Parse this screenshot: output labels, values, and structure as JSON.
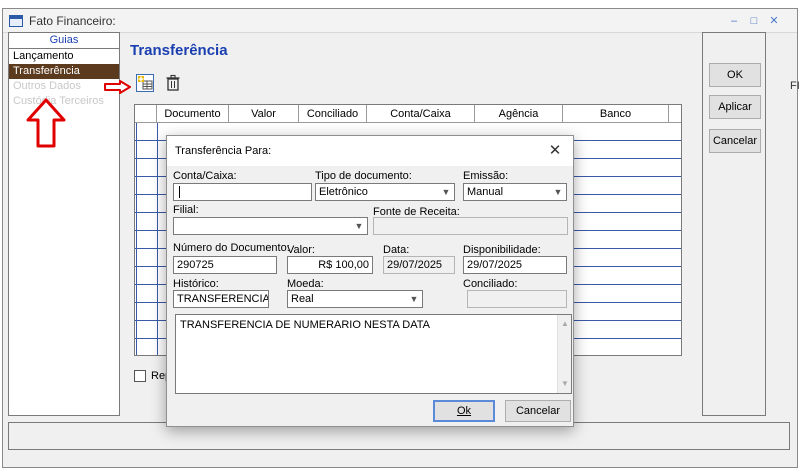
{
  "window": {
    "title": "Fato Financeiro:",
    "controls": {
      "minimize": "–",
      "maximize": "□",
      "close": "✕"
    }
  },
  "sidebar": {
    "header": "Guias",
    "items": [
      {
        "label": "Lançamento",
        "state": "normal"
      },
      {
        "label": "Transferência",
        "state": "active"
      },
      {
        "label": "Outros Dados",
        "state": "disabled"
      },
      {
        "label": "Custódia Terceiros",
        "state": "disabled"
      }
    ]
  },
  "main": {
    "title": "Transferência",
    "toolbar": {
      "add_icon": "add-row-icon",
      "delete_icon": "trash-icon"
    },
    "grid": {
      "columns": [
        "Documento",
        "Valor",
        "Conciliado",
        "Conta/Caixa",
        "Agência",
        "Banco"
      ]
    },
    "repeat_label": "Rep"
  },
  "actions": {
    "ok": "OK",
    "apply": "Aplicar",
    "cancel": "Cancelar"
  },
  "clipped_text": "FI",
  "dialog": {
    "title": "Transferência Para:",
    "close": "✕",
    "fields": {
      "conta_caixa": {
        "label": "Conta/Caixa:",
        "value": ""
      },
      "tipo_documento": {
        "label": "Tipo de documento:",
        "value": "Eletrônico"
      },
      "emissao": {
        "label": "Emissão:",
        "value": "Manual"
      },
      "filial": {
        "label": "Filial:",
        "value": ""
      },
      "fonte_receita": {
        "label": "Fonte de Receita:",
        "value": ""
      },
      "numero_documento": {
        "label": "Número do Documento:",
        "value": "290725"
      },
      "valor": {
        "label": "Valor:",
        "value": "R$ 100,00"
      },
      "data": {
        "label": "Data:",
        "value": "29/07/2025"
      },
      "disponibilidade": {
        "label": "Disponibilidade:",
        "value": "29/07/2025"
      },
      "historico": {
        "label": "Histórico:",
        "value": "TRANSFERENCIA"
      },
      "moeda": {
        "label": "Moeda:",
        "value": "Real"
      },
      "conciliado": {
        "label": "Conciliado:",
        "value": ""
      },
      "memo": "TRANSFERENCIA DE NUMERARIO NESTA DATA"
    },
    "buttons": {
      "ok": "Ok",
      "cancel": "Cancelar"
    }
  },
  "colors": {
    "accent_blue": "#1a3fb0",
    "active_nav": "#5c3a1e",
    "annotation_red": "#e00000",
    "grid_lines": "#3a5aa8"
  }
}
